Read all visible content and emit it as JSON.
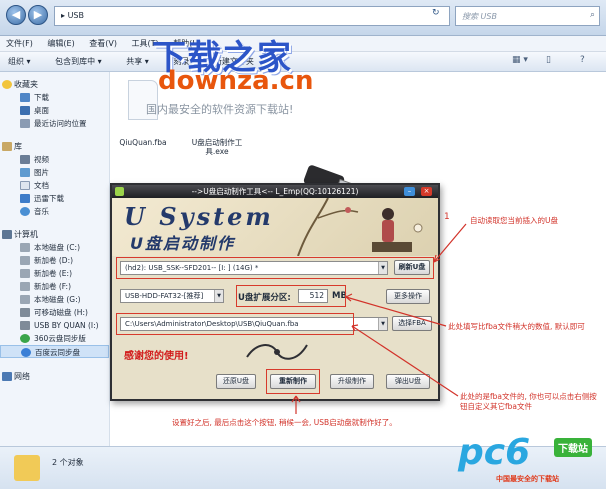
{
  "address_bar": {
    "path_sep": "▸",
    "path": "USB",
    "search_placeholder": "搜索 USB",
    "refresh_glyph": "↻",
    "search_glyph": "⌕"
  },
  "menu": [
    "文件(F)",
    "编辑(E)",
    "查看(V)",
    "工具(T)",
    "帮助(H)"
  ],
  "toolbar": {
    "items": [
      "组织 ▾",
      "包含到库中 ▾",
      "共享 ▾",
      "刻录",
      "新建文件夹"
    ],
    "view_glyph": "▦ ▾",
    "pane_glyph": "▯",
    "help_glyph": "?"
  },
  "sidebar": {
    "favorites": {
      "label": "收藏夹",
      "items": [
        "下载",
        "桌面",
        "最近访问的位置"
      ]
    },
    "libraries": {
      "label": "库",
      "items": [
        "视频",
        "图片",
        "文档",
        "迅雷下载",
        "音乐"
      ]
    },
    "computer": {
      "label": "计算机",
      "items": [
        "本地磁盘 (C:)",
        "新加卷 (D:)",
        "新加卷 (E:)",
        "新加卷 (F:)",
        "本地磁盘 (G:)",
        "可移动磁盘 (H:)",
        "USB BY QUAN (I:)",
        "360云盘同步版",
        "百度云同步盘"
      ]
    },
    "network": {
      "label": "网络"
    }
  },
  "files": [
    {
      "name": "QiuQuan.fba"
    },
    {
      "name": "U盘启动制作工具.exe"
    }
  ],
  "watermark": {
    "title": "下载之家",
    "url": "downza.cn",
    "sub": "国内最安全的软件资源下载站!"
  },
  "status": {
    "count": "2 个对象"
  },
  "pc6": {
    "big": "pc6",
    "badge": "下载站",
    "sub": "中国最安全的下载站"
  },
  "dialog": {
    "title": "-->U盘启动制作工具<-- L_Emp(QQ:10126121)",
    "banner_logo": "U System",
    "banner_sub": "U盘启动制作",
    "disk_select": "(hd2): USB_SSK--SFD201-- [I: ] (14G) *",
    "refresh_btn": "刷新U盘",
    "mode_select": "USB-HDD-FAT32-[推荐]",
    "part_label": "U盘扩展分区:",
    "part_value": "512",
    "part_unit": "MB",
    "more_btn": "更多操作",
    "file_path": "C:\\Users\\Administrator\\Desktop\\USB\\QiuQuan.fba",
    "choose_btn": "选择FBA",
    "thanks": "感谢您的使用!",
    "buttons": [
      "还原U盘",
      "重新制作",
      "升级制作",
      "弹出U盘"
    ],
    "close_glyph": "×",
    "min_glyph": "–"
  },
  "annotations": {
    "a1_number": "1",
    "a1_text": "自动读取您当前插入的U盘",
    "a2_text": "此处填写比fba文件稍大的数值, 默认即可",
    "a3_text": "此处的是fba文件的, 你也可以点击右侧按钮自定义其它fba文件",
    "a4_text": "设置好之后, 最后点击这个按钮, 稍候一会, USB启动盘就制作好了。"
  },
  "colors": {
    "annotation": "#d2332a",
    "accent": "#2c55c8"
  }
}
